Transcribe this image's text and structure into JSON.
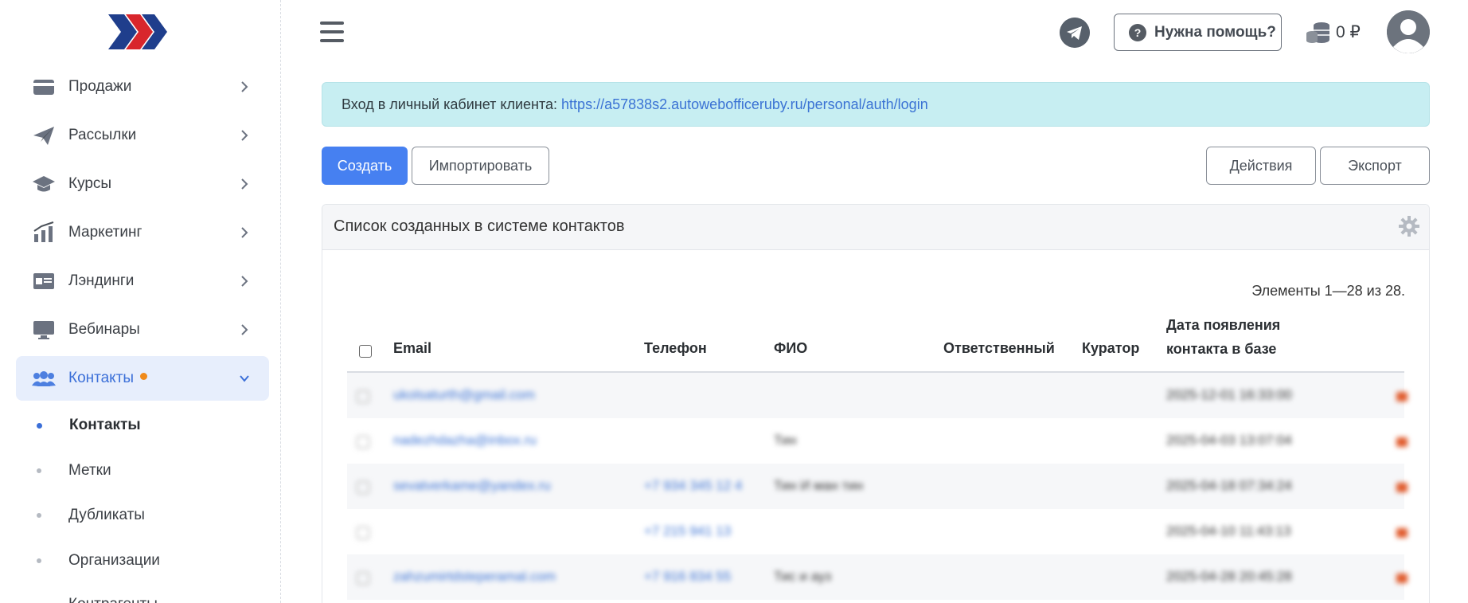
{
  "sidebar": {
    "items": [
      {
        "label": "Продажи",
        "icon": "wallet-icon"
      },
      {
        "label": "Рассылки",
        "icon": "paper-plane-icon"
      },
      {
        "label": "Курсы",
        "icon": "graduation-cap-icon"
      },
      {
        "label": "Маркетинг",
        "icon": "chart-bars-icon"
      },
      {
        "label": "Лэндинги",
        "icon": "landing-page-icon"
      },
      {
        "label": "Вебинары",
        "icon": "monitor-icon"
      },
      {
        "label": "Контакты",
        "icon": "users-icon"
      }
    ],
    "subitems": [
      {
        "label": "Контакты"
      },
      {
        "label": "Метки"
      },
      {
        "label": "Дубликаты"
      },
      {
        "label": "Организации"
      },
      {
        "label": "Контрагенты"
      }
    ]
  },
  "header": {
    "help_label": "Нужна помощь?",
    "balance": "0 ₽"
  },
  "alert": {
    "text": "Вход в личный кабинет клиента:",
    "link": "https://a57838s2.autowebofficeruby.ru/personal/auth/login"
  },
  "toolbar": {
    "create": "Создать",
    "import": "Импортировать",
    "actions": "Действия",
    "export": "Экспорт"
  },
  "card": {
    "title": "Список созданных в системе контактов",
    "summary": "Элементы 1—28 из 28.",
    "columns": {
      "email": "Email",
      "phone": "Телефон",
      "fio": "ФИО",
      "responsible": "Ответственный",
      "curator": "Куратор",
      "date_line1": "Дата появления",
      "date_line2": "контакта в базе"
    },
    "rows": [
      {
        "email": "ukolsaturth@gmail.com",
        "phone": "",
        "fio": "",
        "date": "2025-12-01 16:33:00"
      },
      {
        "email": "nadezhdazha@inbox.ru",
        "phone": "",
        "fio": "Тин",
        "date": "2025-04-03 13:07:04"
      },
      {
        "email": "sevatverkame@yandex.ru",
        "phone": "+7 934 345 12 4",
        "fio": "Тин И ман тин",
        "date": "2025-04-18 07:34:24"
      },
      {
        "email": "",
        "phone": "+7 215 941 13",
        "fio": "",
        "date": "2025-04-10 11:43:13"
      },
      {
        "email": "zahzumirtdsteperamal.com",
        "phone": "+7 916 834 55",
        "fio": "Тис и ауз",
        "date": "2025-04-28 20:45:28"
      }
    ]
  },
  "colors": {
    "accent": "#4680f1",
    "alert_bg": "#c7eef2",
    "active_bg": "#e7eefc"
  }
}
